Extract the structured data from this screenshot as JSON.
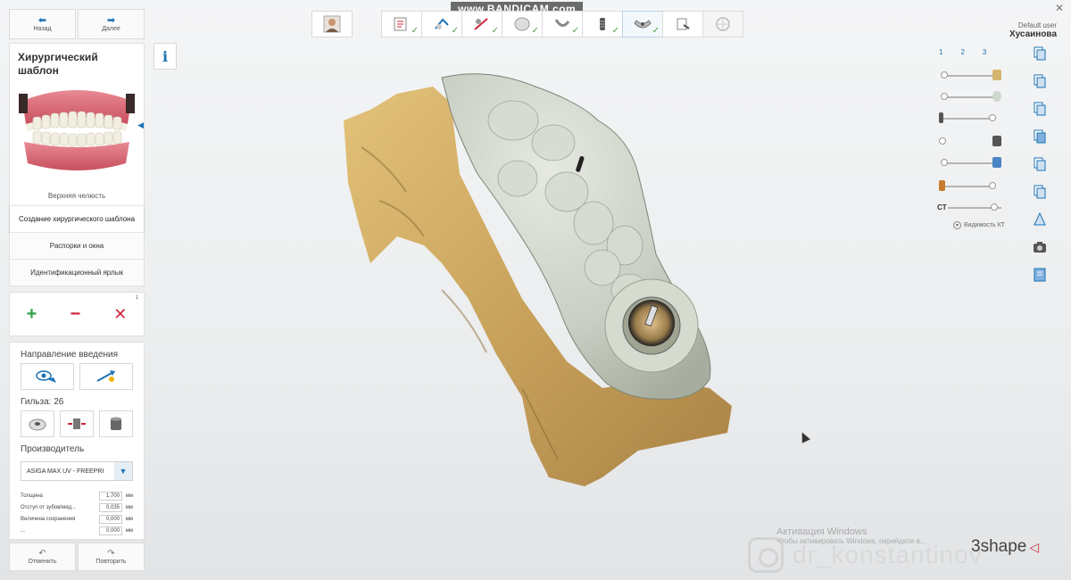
{
  "recorder_watermark": "www.BANDICAM.com",
  "navigation": {
    "back_label": "Назад",
    "next_label": "Далее"
  },
  "panel": {
    "title": "Хирургический шаблон",
    "jaw_caption": "Верхняя челюсть",
    "steps": [
      "Создание хирургического шаблона",
      "Распорки и окна",
      "Идентификационный ярлык"
    ]
  },
  "actions": {
    "index": "1",
    "add_icon": "plus-icon",
    "remove_icon": "minus-icon",
    "delete_icon": "cross-icon"
  },
  "insertion_direction": {
    "label": "Направление введения"
  },
  "sleeve": {
    "label": "Гильза: 26"
  },
  "manufacturer": {
    "label": "Производитель",
    "selected": "ASIGA MAX UV - FREEPRI"
  },
  "parameters": [
    {
      "name": "Толщина",
      "value": "1,700",
      "unit": "мм"
    },
    {
      "name": "Отступ от зубов/мяд...",
      "value": "0,035",
      "unit": "мм"
    },
    {
      "name": "Величина сохранения",
      "value": "0,000",
      "unit": "мм"
    },
    {
      "name": "...",
      "value": "0,000",
      "unit": "мм"
    }
  ],
  "history": {
    "undo_label": "Отменить",
    "redo_label": "Повторить"
  },
  "user": {
    "role": "Default user",
    "name": "Хусаинова"
  },
  "visibility": {
    "tabs": [
      "1",
      "2",
      "3"
    ],
    "ct_label": "CT",
    "ct_visibility_label": "Видимость КТ"
  },
  "windows_activation": {
    "title": "Активация Windows",
    "message": "Чтобы активировать Windows, перейдите в..."
  },
  "instagram_handle": "dr_konstantinov",
  "brand": "3shape",
  "colors": {
    "accent": "#1b73b5",
    "add": "#2ea043",
    "delete": "#d0243a",
    "check": "#48a23f",
    "brand_triangle": "#d12b3a"
  }
}
